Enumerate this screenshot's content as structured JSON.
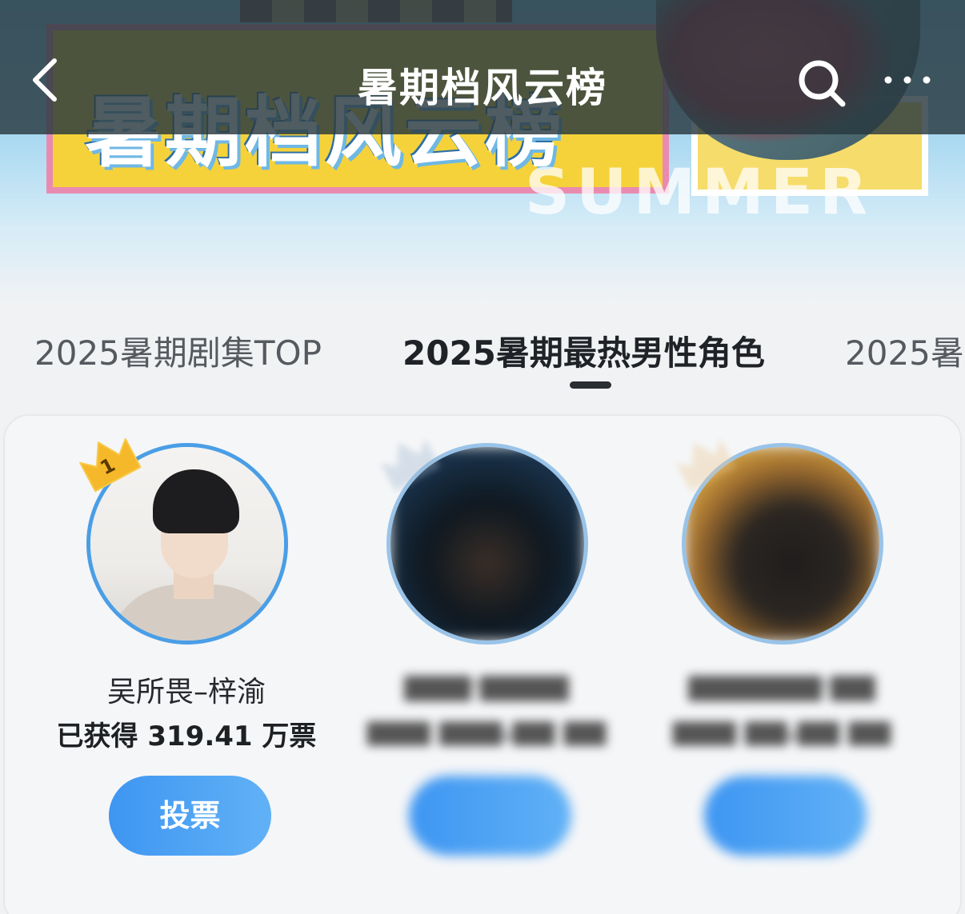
{
  "header": {
    "title": "暑期档风云榜"
  },
  "hero": {
    "poster_title": "暑期档风云榜",
    "poster_subtitle": "SUMMER"
  },
  "tabs": [
    {
      "label": "2025暑期剧集TOP",
      "active": false
    },
    {
      "label": "2025暑期最热男性角色",
      "active": true
    },
    {
      "label": "2025暑",
      "active": false
    }
  ],
  "candidates": [
    {
      "rank": "1",
      "name": "吴所畏–梓渝",
      "votes": "已获得 319.41 万票",
      "vote_label": "投票",
      "blurred": false
    },
    {
      "rank": "2",
      "name": "",
      "votes": "",
      "vote_label": "",
      "blurred": true
    },
    {
      "rank": "3",
      "name": "",
      "votes": "",
      "vote_label": "",
      "blurred": true
    }
  ],
  "colors": {
    "accent": "#4a9ee6",
    "vote_button": "#3e96f2",
    "crown_gold": "#f5b82a",
    "topbar": "#28383e"
  },
  "icons": {
    "back": "chevron-left-icon",
    "search": "search-icon",
    "more": "more-horizontal-icon",
    "crown": "crown-icon"
  }
}
